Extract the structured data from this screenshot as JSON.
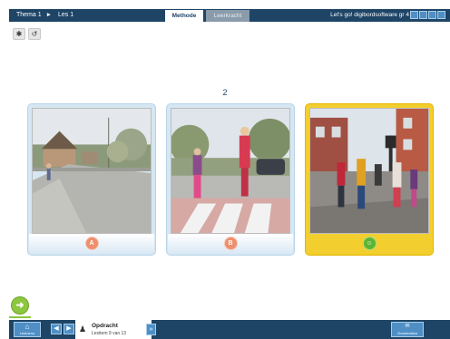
{
  "header": {
    "breadcrumb": {
      "theme": "Thema 1",
      "lesson": "Les 1"
    },
    "tabs": [
      {
        "label": "Methode",
        "active": true
      },
      {
        "label": "Leerkracht",
        "active": false
      }
    ],
    "app_title": "Let's go! digibordsoftware gr 4",
    "window_icons": [
      "minimize-icon",
      "restore-icon",
      "info-icon",
      "close-icon"
    ]
  },
  "toolbar": {
    "tools": [
      "settings-icon",
      "reset-icon"
    ]
  },
  "page_number": "2",
  "cards": [
    {
      "label": "A",
      "selected": false,
      "scene": "girl walking on suburban road"
    },
    {
      "label": "B",
      "selected": false,
      "scene": "woman and child on zebra crossing"
    },
    {
      "label": "☺",
      "selected": true,
      "scene": "pedestrians crossing busy street"
    }
  ],
  "footer": {
    "lesmenu_label": "Lesmenu",
    "task_title": "Opdracht",
    "task_step": "Lesitem 9 van 13",
    "grammar_label": "Grammatica"
  },
  "colors": {
    "bar": "#1e4466",
    "accent": "#4f8fc6",
    "selected": "#f2cf2e",
    "badge": "#ee8f6d",
    "correct": "#5cb531"
  }
}
